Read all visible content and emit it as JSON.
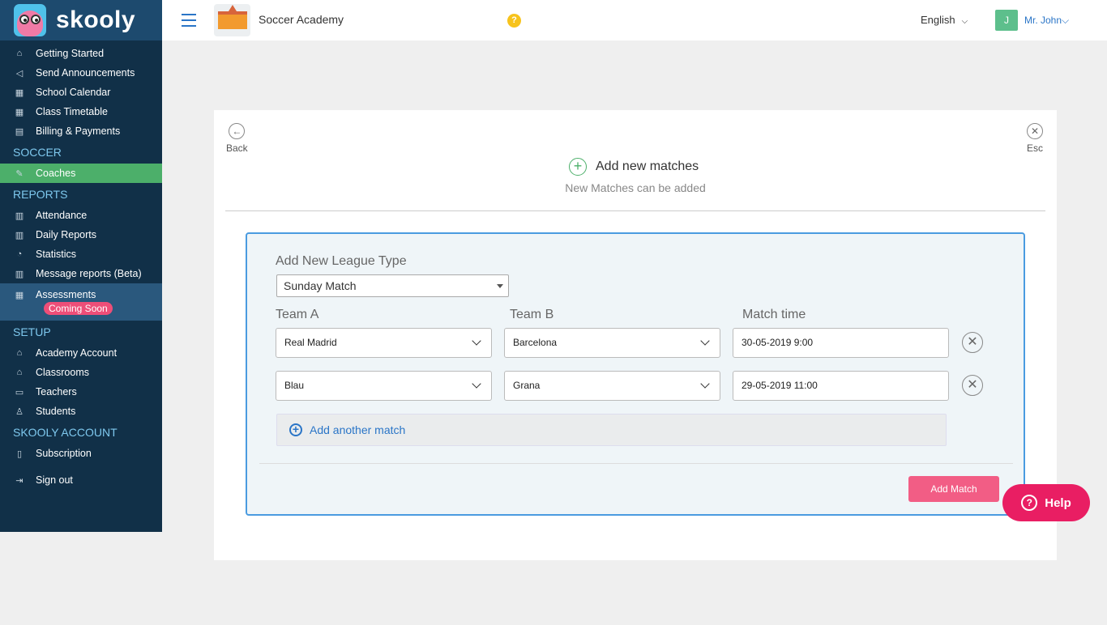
{
  "brand": {
    "name": "skooly"
  },
  "sidebar": {
    "top_items": [
      {
        "label": "Getting Started",
        "icon": "home-icon"
      },
      {
        "label": "Send Announcements",
        "icon": "megaphone-icon"
      },
      {
        "label": "School Calendar",
        "icon": "calendar-icon"
      },
      {
        "label": "Class Timetable",
        "icon": "timetable-icon"
      },
      {
        "label": "Billing & Payments",
        "icon": "billing-icon"
      }
    ],
    "section_soccer": "SOCCER",
    "coaches": "Coaches",
    "section_reports": "REPORTS",
    "reports": [
      {
        "label": "Attendance"
      },
      {
        "label": "Daily Reports"
      },
      {
        "label": "Statistics"
      },
      {
        "label": "Message reports (Beta)"
      }
    ],
    "assessments": "Assessments",
    "coming_soon": "Coming Soon",
    "section_setup": "SETUP",
    "setup": [
      {
        "label": "Academy Account"
      },
      {
        "label": "Classrooms"
      },
      {
        "label": "Teachers"
      },
      {
        "label": "Students"
      }
    ],
    "section_account": "SKOOLY ACCOUNT",
    "subscription": "Subscription",
    "signout": "Sign out"
  },
  "header": {
    "school_name": "Soccer Academy",
    "help_badge": "?",
    "language": "English",
    "avatar_initial": "J",
    "user": "Mr. John"
  },
  "card": {
    "back": "Back",
    "esc": "Esc",
    "title": "Add new matches",
    "subtitle": "New Matches can be added",
    "league_label": "Add New League Type",
    "league_value": "Sunday Match",
    "team_a_label": "Team A",
    "team_b_label": "Team B",
    "time_label": "Match time",
    "matches": [
      {
        "team_a": "Real Madrid",
        "team_b": "Barcelona",
        "time": "30-05-2019 9:00"
      },
      {
        "team_a": "Blau",
        "team_b": "Grana",
        "time": "29-05-2019 11:00"
      }
    ],
    "add_another": "Add another match",
    "add_match": "Add Match"
  },
  "help": {
    "label": "Help"
  }
}
